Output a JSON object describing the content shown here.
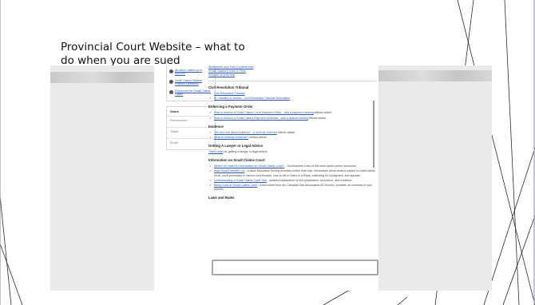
{
  "slide": {
    "title": "Provincial Court Website – what to do when you are sued"
  },
  "left_menu": [
    {
      "icon": "circle-arrow-icon",
      "label": "All other Claims up to $35,000"
    },
    {
      "icon": "circle-arrow-icon",
      "label": "Small Claims Matters Practice Directions"
    },
    {
      "icon": "circle-arrow-icon",
      "label": "Resources for Small Claims Cases"
    }
  ],
  "share": {
    "title": "Share",
    "items": [
      "Recommend",
      "Tweet",
      "Email"
    ]
  },
  "top_links": [
    "Settlement and Trial Conferences",
    "Small Claims Forms & Fees",
    "Support at your trial"
  ],
  "sections": {
    "crt": {
      "heading": "Civil Resolution Tribunal",
      "items": [
        "Civil Resolution Tribunal",
        "BC Ministry of Justice - Civil Resolution Tribunal Information"
      ]
    },
    "enforce": {
      "heading": "Enforcing a Payment Order",
      "items": [
        {
          "link": "How to enforce a Small Claims Court Payment Order - with a payment hearing",
          "rest": " eNews article"
        },
        {
          "link": "How to enforce a Small Claims Payment Schedule - with a default hearing",
          "rest": " eNews article"
        }
      ]
    },
    "evidence": {
      "heading": "Evidence",
      "items": [
        {
          "link": "The first rule about evidence – it must be relevant",
          "rest": " eNews article"
        },
        {
          "link": "What is hearsay evidence?",
          "rest": " eNews article"
        }
      ]
    },
    "lawyer": {
      "heading": "Getting A Lawyer or Legal Advice",
      "link": "Useful links",
      "rest": " for getting a lawyer or legal advice"
    },
    "info": {
      "heading": "Information on Small Claims Court",
      "items": [
        {
          "link": "Where do I start for information on Small Claims Court?",
          "rest": " - Summarizes a few of the most useful online resources"
        },
        {
          "link": "www.SmallClaimsBC.ca",
          "rest": " - Justice Education Society provides online chat help, information about what to expect in small claims court, court processes in various courthouses, how to file a Claim or a Reply, collecting on a judgment, and appeals"
        },
        {
          "link": "Understanding a Small Claims Court Trial",
          "rest": " - detailed explanation of trial preparation, procedure, and evidence"
        },
        {
          "link": "Being Sued in Small Claims Court",
          "rest": " - a fact sheet from the Canadian Bar Association BC Branch, provides an overview of your options"
        }
      ]
    },
    "laws": {
      "heading": "Laws and Rules"
    }
  }
}
